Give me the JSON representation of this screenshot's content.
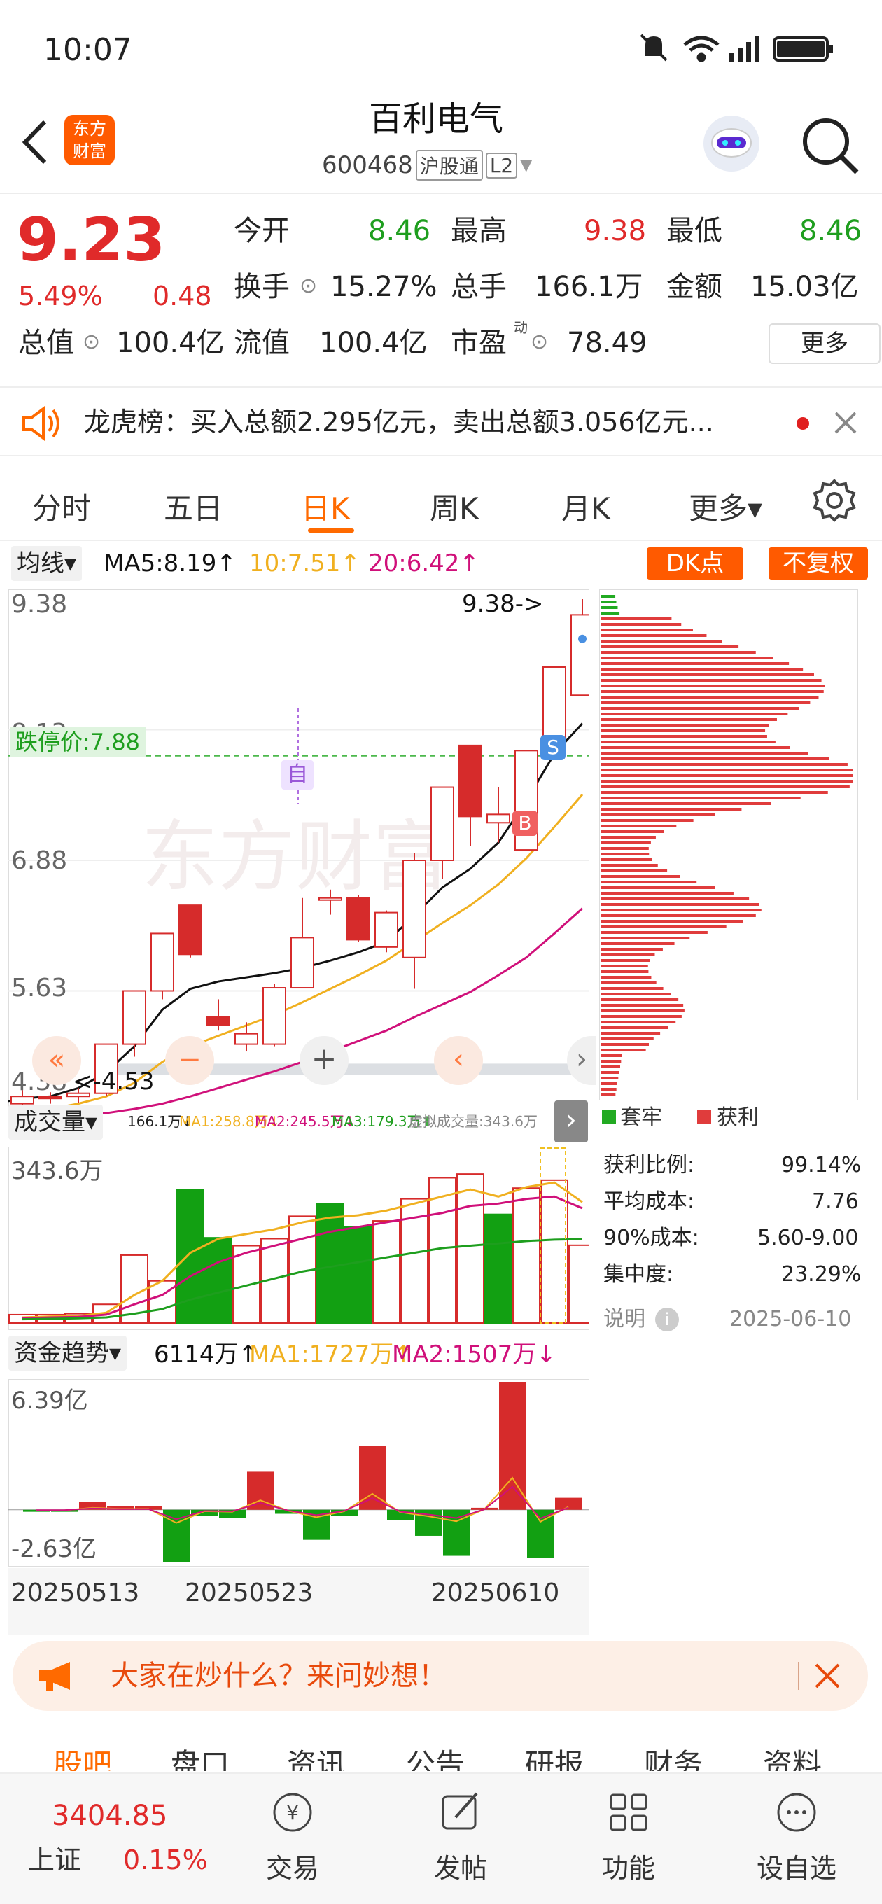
{
  "status": {
    "time": "10:07"
  },
  "header": {
    "title": "百利电气",
    "code": "600468",
    "tag": "沪股通",
    "level": "L2",
    "logo_line1": "东方",
    "logo_line2": "财富"
  },
  "quote": {
    "price": "9.23",
    "change_pct": "5.49%",
    "change": "0.48",
    "open_label": "今开",
    "open": "8.46",
    "high_label": "最高",
    "high": "9.38",
    "low_label": "最低",
    "low": "8.46",
    "turnover_label": "换手",
    "turnover": "15.27%",
    "volume_label": "总手",
    "volume": "166.1万",
    "amount_label": "金额",
    "amount": "15.03亿",
    "mktcap_label": "总值",
    "mktcap": "100.4亿",
    "float_label": "流值",
    "float": "100.4亿",
    "pe_label": "市盈",
    "pe_sup": "动",
    "pe": "78.49",
    "more": "更多"
  },
  "notice": {
    "text": "龙虎榜：买入总额2.295亿元，卖出总额3.056亿元..."
  },
  "tabs": [
    {
      "label": "分时"
    },
    {
      "label": "五日"
    },
    {
      "label": "日K"
    },
    {
      "label": "周K"
    },
    {
      "label": "月K"
    },
    {
      "label": "更多▾"
    }
  ],
  "kline": {
    "ma_select": "均线▾",
    "ma5": "MA5:8.19↑",
    "ma10": "10:7.51↑",
    "ma20": "20:6.42↑",
    "dk": "DK点",
    "fq": "不复权",
    "y_labels": [
      "9.38",
      "8.13",
      "6.88",
      "5.63",
      "4.38"
    ],
    "limit_down": "跌停价:7.88",
    "max_mark": "9.38->",
    "min_mark": "<-4.53",
    "zi": "自",
    "s": "S",
    "b": "B",
    "watermark": "东方财富",
    "colors": {
      "up": "#d62b2b",
      "down": "#12a012",
      "ma5": "#111111",
      "ma10": "#f0b020",
      "ma20": "#d0107a"
    }
  },
  "chip": {
    "legend_trap": "套牢",
    "legend_profit": "获利",
    "rows": [
      {
        "label": "获利比例:",
        "value": "99.14%"
      },
      {
        "label": "平均成本:",
        "value": "7.76"
      },
      {
        "label": "90%成本:",
        "value": "5.60-9.00"
      },
      {
        "label": "集中度:",
        "value": "23.29%"
      }
    ],
    "note": "说明",
    "date": "2025-06-10"
  },
  "volume": {
    "select": "成交量▾",
    "cur": "166.1万↓",
    "ma1": "MA1:258.8万↓",
    "ma2": "MA2:245.5万↓",
    "ma3": "MA3:179.3万↑",
    "virtual": "虚拟成交量:343.6万",
    "y_top": "343.6万"
  },
  "fund": {
    "select": "资金趋势▾",
    "cur": "6114万↑",
    "ma1": "MA1:1727万↑",
    "ma2": "MA2:1507万↓",
    "y_top": "6.39亿",
    "y_bottom": "-2.63亿"
  },
  "dates": [
    "20250513",
    "20250523",
    "20250610"
  ],
  "chart_data": {
    "type": "candlestick",
    "ylim": [
      4.38,
      9.38
    ],
    "candles": [
      {
        "o": 4.55,
        "c": 4.62,
        "h": 4.68,
        "l": 4.53
      },
      {
        "o": 4.62,
        "c": 4.6,
        "h": 4.66,
        "l": 4.55
      },
      {
        "o": 4.62,
        "c": 4.65,
        "h": 4.7,
        "l": 4.56
      },
      {
        "o": 4.65,
        "c": 5.12,
        "h": 5.12,
        "l": 4.62
      },
      {
        "o": 5.12,
        "c": 5.63,
        "h": 5.63,
        "l": 5.0
      },
      {
        "o": 5.63,
        "c": 6.18,
        "h": 6.18,
        "l": 5.55
      },
      {
        "o": 6.45,
        "c": 5.98,
        "h": 6.45,
        "l": 5.95
      },
      {
        "o": 5.38,
        "c": 5.3,
        "h": 5.55,
        "l": 5.25
      },
      {
        "o": 5.12,
        "c": 5.22,
        "h": 5.33,
        "l": 5.05
      },
      {
        "o": 5.12,
        "c": 5.66,
        "h": 5.7,
        "l": 5.1
      },
      {
        "o": 5.66,
        "c": 6.14,
        "h": 6.52,
        "l": 5.66
      },
      {
        "o": 6.52,
        "c": 6.52,
        "h": 6.6,
        "l": 6.36
      },
      {
        "o": 6.52,
        "c": 6.12,
        "h": 6.55,
        "l": 6.1
      },
      {
        "o": 6.05,
        "c": 6.38,
        "h": 6.4,
        "l": 6.0
      },
      {
        "o": 5.95,
        "c": 6.88,
        "h": 6.95,
        "l": 5.65
      },
      {
        "o": 6.88,
        "c": 7.58,
        "h": 7.58,
        "l": 6.7
      },
      {
        "o": 7.98,
        "c": 7.3,
        "h": 7.98,
        "l": 7.02
      },
      {
        "o": 7.24,
        "c": 7.32,
        "h": 7.58,
        "l": 7.05
      },
      {
        "o": 6.98,
        "c": 7.93,
        "h": 7.93,
        "l": 6.98
      },
      {
        "o": 7.93,
        "c": 8.73,
        "h": 8.73,
        "l": 7.88
      },
      {
        "o": 8.46,
        "c": 9.23,
        "h": 9.38,
        "l": 8.46
      }
    ],
    "ma5": [
      4.55,
      4.6,
      4.62,
      4.7,
      4.85,
      5.1,
      5.45,
      5.65,
      5.72,
      5.76,
      5.8,
      5.85,
      5.92,
      6.0,
      6.1,
      6.35,
      6.62,
      6.8,
      7.05,
      7.45,
      7.9,
      8.19
    ],
    "ma10": [
      4.45,
      4.48,
      4.5,
      4.55,
      4.62,
      4.75,
      4.95,
      5.1,
      5.2,
      5.3,
      5.4,
      5.52,
      5.65,
      5.78,
      5.92,
      6.1,
      6.28,
      6.45,
      6.65,
      6.9,
      7.2,
      7.51
    ],
    "ma20": [
      4.4,
      4.4,
      4.42,
      4.44,
      4.46,
      4.5,
      4.55,
      4.62,
      4.7,
      4.78,
      4.86,
      4.95,
      5.05,
      5.15,
      5.25,
      5.38,
      5.5,
      5.62,
      5.78,
      5.95,
      6.18,
      6.42
    ],
    "volume": {
      "max": 343.6,
      "bars": [
        {
          "v": 18,
          "up": true
        },
        {
          "v": 18,
          "up": true
        },
        {
          "v": 20,
          "up": true
        },
        {
          "v": 40,
          "up": true
        },
        {
          "v": 145,
          "up": true
        },
        {
          "v": 90,
          "up": true
        },
        {
          "v": 285,
          "up": false
        },
        {
          "v": 182,
          "up": false
        },
        {
          "v": 165,
          "up": true
        },
        {
          "v": 180,
          "up": true
        },
        {
          "v": 228,
          "up": true
        },
        {
          "v": 255,
          "up": false
        },
        {
          "v": 205,
          "up": false
        },
        {
          "v": 218,
          "up": true
        },
        {
          "v": 265,
          "up": true
        },
        {
          "v": 310,
          "up": true
        },
        {
          "v": 318,
          "up": true
        },
        {
          "v": 232,
          "up": false
        },
        {
          "v": 288,
          "up": true
        },
        {
          "v": 305,
          "up": true
        },
        {
          "v": 166.1,
          "up": true
        }
      ]
    },
    "fund_flow": {
      "max": 6.39,
      "min": -2.63,
      "values": [
        -0.1,
        -0.1,
        0.4,
        0.2,
        0.2,
        -2.63,
        -0.3,
        -0.4,
        1.9,
        -0.2,
        -1.5,
        -0.3,
        3.2,
        -0.5,
        -1.3,
        -2.3,
        0.1,
        6.39,
        -2.4,
        0.6
      ]
    }
  }
}
